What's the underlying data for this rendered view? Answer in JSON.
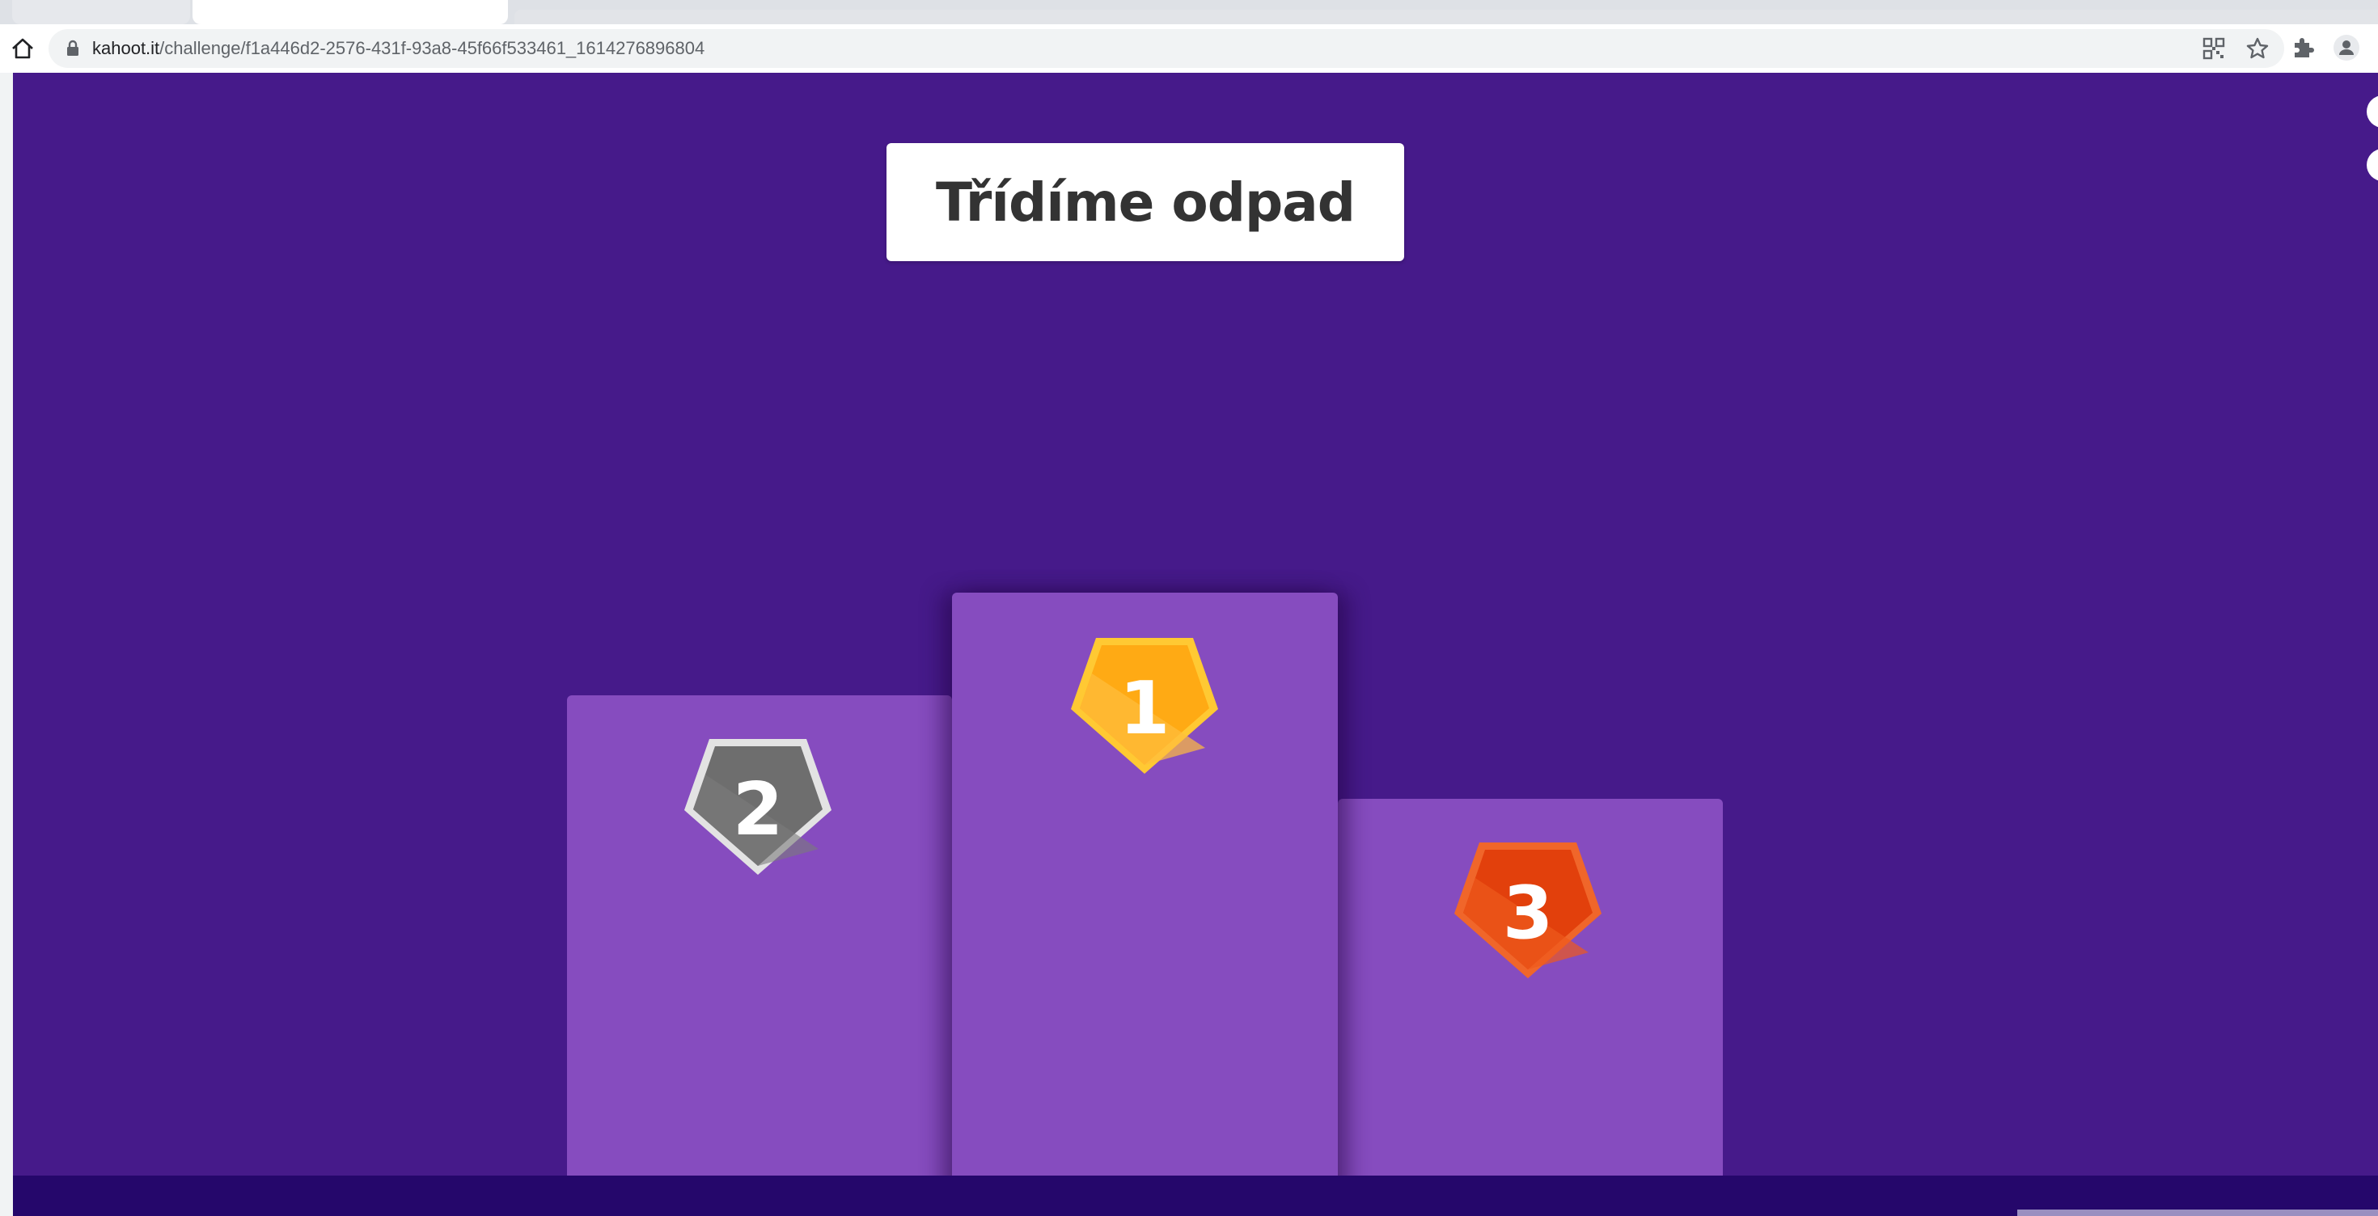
{
  "browser": {
    "url_host": "kahoot.it",
    "url_path": "/challenge/f1a446d2-2576-431f-93a8-45f66f533461_1614276896804",
    "icons": [
      "home-icon",
      "lock-icon",
      "qr-code-icon",
      "bookmark-star-icon",
      "extensions-puzzle-icon",
      "profile-avatar-icon"
    ]
  },
  "page": {
    "title": "Třídíme odpad",
    "background_color": "#461a8a",
    "podium_color": "#864cbf",
    "places": [
      {
        "rank": "2",
        "medal": "silver",
        "color": "#757575"
      },
      {
        "rank": "1",
        "medal": "gold",
        "color": "#ffb12a"
      },
      {
        "rank": "3",
        "medal": "bronze",
        "color": "#e8470f"
      }
    ]
  }
}
